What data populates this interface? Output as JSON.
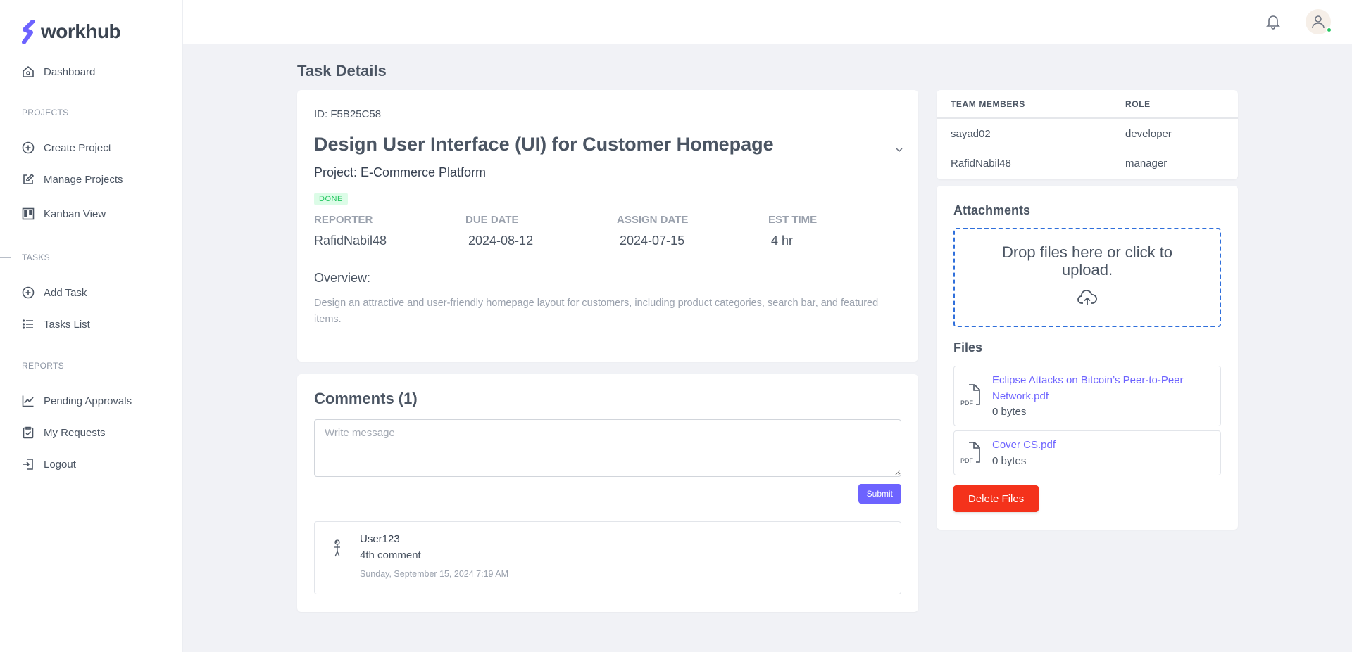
{
  "brand": {
    "name": "workhub",
    "logo_icon": "workhub-s-logo-icon",
    "accent": "#6d63ff"
  },
  "sidebar": {
    "top_items": [
      {
        "label": "Dashboard",
        "icon": "home-icon"
      }
    ],
    "sections": [
      {
        "label": "PROJECTS",
        "items": [
          {
            "label": "Create Project",
            "icon": "plus-circle-icon"
          },
          {
            "label": "Manage Projects",
            "icon": "edit-icon"
          },
          {
            "label": "Kanban View",
            "icon": "kanban-icon"
          }
        ]
      },
      {
        "label": "TASKS",
        "items": [
          {
            "label": "Add Task",
            "icon": "plus-circle-icon"
          },
          {
            "label": "Tasks List",
            "icon": "list-icon"
          }
        ]
      },
      {
        "label": "REPORTS",
        "items": [
          {
            "label": "Pending Approvals",
            "icon": "chart-line-icon"
          },
          {
            "label": "My Requests",
            "icon": "clipboard-check-icon"
          },
          {
            "label": "Logout",
            "icon": "logout-icon"
          }
        ]
      }
    ]
  },
  "header": {
    "bell_icon": "bell-icon",
    "avatar_icon": "user-icon",
    "online_color": "#22c55e"
  },
  "page": {
    "title": "Task Details"
  },
  "task": {
    "id_text": "ID: F5B25C58",
    "title": "Design User Interface (UI) for Customer Homepage",
    "project_text": "Project: E-Commerce Platform",
    "status": "DONE",
    "meta": [
      {
        "label": "REPORTER",
        "value": "RafidNabil48"
      },
      {
        "label": "DUE DATE",
        "value": "2024-08-12"
      },
      {
        "label": "ASSIGN DATE",
        "value": "2024-07-15"
      },
      {
        "label": "EST TIME",
        "value": "4 hr"
      }
    ],
    "overview_label": "Overview:",
    "overview_text": "Design an attractive and user-friendly homepage layout for customers, including product categories, search bar, and featured items."
  },
  "comments": {
    "title": "Comments (1)",
    "placeholder": "Write message",
    "value": "",
    "submit_label": "Submit",
    "items": [
      {
        "user": "User123",
        "text": "4th comment",
        "date": "Sunday, September 15, 2024 7:19 AM"
      }
    ]
  },
  "team": {
    "headers": [
      "TEAM MEMBERS",
      "ROLE"
    ],
    "rows": [
      {
        "member": "sayad02",
        "role": "developer"
      },
      {
        "member": "RafidNabil48",
        "role": "manager"
      }
    ]
  },
  "attachments": {
    "title": "Attachments",
    "dropzone_text": "Drop files here or click to upload.",
    "upload_icon": "cloud-upload-icon",
    "files_title": "Files",
    "files": [
      {
        "name": "Eclipse Attacks on Bitcoin’s Peer-to-Peer Network.pdf",
        "size": "0 bytes",
        "icon": "pdf-file-icon"
      },
      {
        "name": "Cover CS.pdf",
        "size": "0 bytes",
        "icon": "pdf-file-icon"
      }
    ],
    "delete_label": "Delete Files",
    "delete_color": "#f4321b"
  }
}
